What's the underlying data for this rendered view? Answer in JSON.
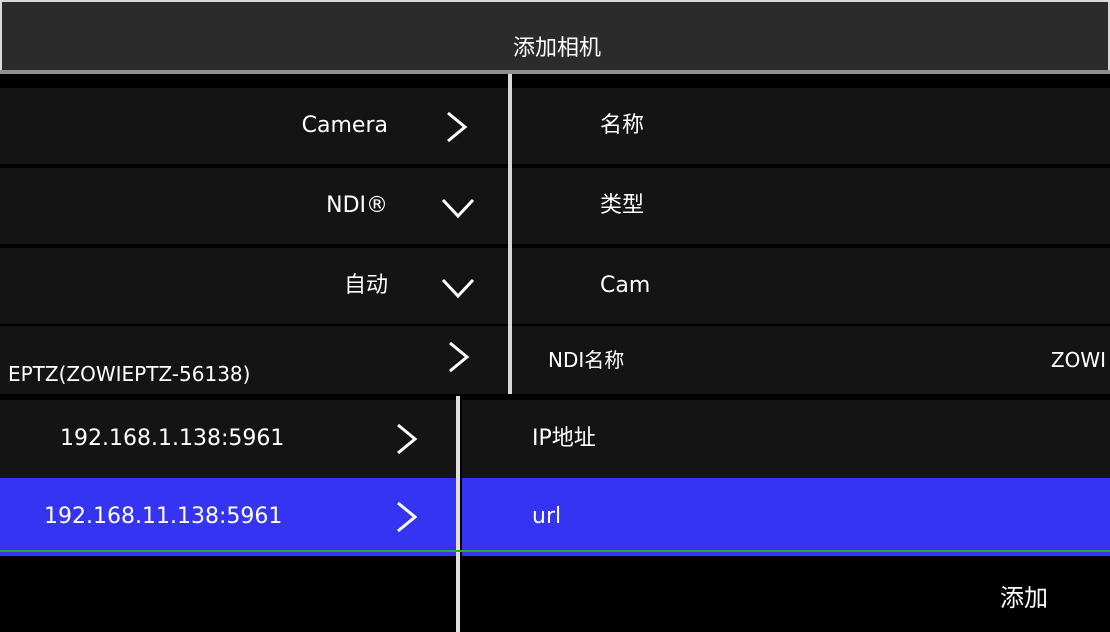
{
  "dialog": {
    "title": "添加相机"
  },
  "left_rows": [
    {
      "label": "Camera",
      "icon": "chevron-right-icon"
    },
    {
      "label": "NDI®",
      "icon": "chevron-down-icon"
    },
    {
      "label": "自动",
      "icon": "chevron-down-icon"
    },
    {
      "label": "EPTZ(ZOWIEPTZ-56138)",
      "icon": "chevron-right-icon"
    }
  ],
  "right_rows": [
    {
      "label": "名称"
    },
    {
      "label": "类型"
    },
    {
      "label": "Cam"
    },
    {
      "label": "NDI名称",
      "value": "ZOWI"
    }
  ],
  "lower_left": [
    {
      "label": "192.168.1.138:5961",
      "icon": "chevron-right-icon",
      "selected": false
    },
    {
      "label": "192.168.11.138:5961",
      "icon": "chevron-right-icon",
      "selected": true
    }
  ],
  "lower_right": [
    {
      "label": "IP地址"
    },
    {
      "label": "url"
    }
  ],
  "actions": {
    "add_label": "添加"
  },
  "colors": {
    "selected": "#3434f2",
    "accent_line": "#31a82c"
  }
}
